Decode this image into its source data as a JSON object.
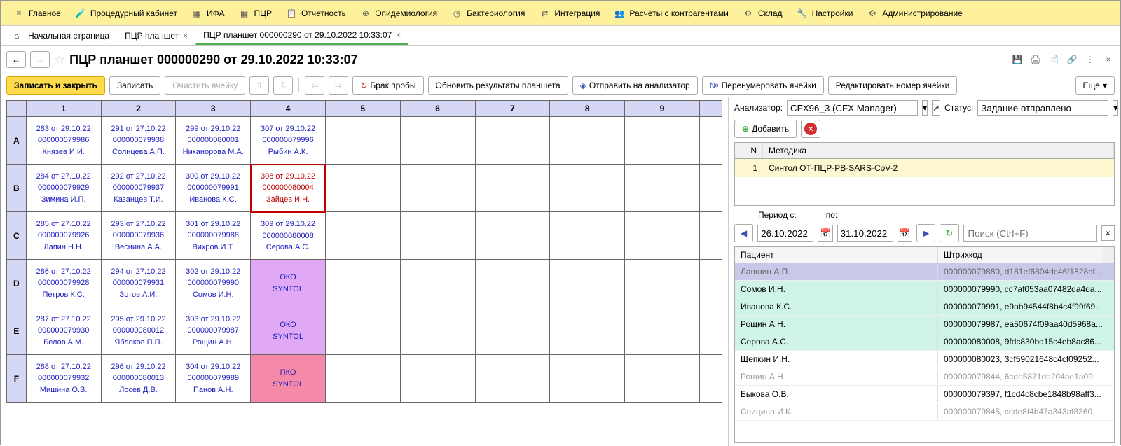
{
  "menubar": {
    "items": [
      {
        "label": "Главное",
        "icon": "menu-icon"
      },
      {
        "label": "Процедурный кабинет",
        "icon": "test-tube-icon"
      },
      {
        "label": "ИФА",
        "icon": "grid-icon"
      },
      {
        "label": "ПЦР",
        "icon": "grid-icon"
      },
      {
        "label": "Отчетность",
        "icon": "clipboard-icon"
      },
      {
        "label": "Эпидемиология",
        "icon": "globe-icon"
      },
      {
        "label": "Бактериология",
        "icon": "clock-icon"
      },
      {
        "label": "Интеграция",
        "icon": "sync-icon"
      },
      {
        "label": "Расчеты с контрагентами",
        "icon": "people-icon"
      },
      {
        "label": "Склад",
        "icon": "settings-icon"
      },
      {
        "label": "Настройки",
        "icon": "wrench-icon"
      },
      {
        "label": "Администрирование",
        "icon": "gear-icon"
      }
    ]
  },
  "tabs": [
    {
      "label": "Начальная страница",
      "closable": false,
      "active": false
    },
    {
      "label": "ПЦР планшет",
      "closable": true,
      "active": false
    },
    {
      "label": "ПЦР планшет 000000290 от 29.10.2022 10:33:07",
      "closable": true,
      "active": true
    }
  ],
  "title": "ПЦР планшет 000000290 от 29.10.2022 10:33:07",
  "toolbar": {
    "save_close": "Записать и закрыть",
    "save": "Записать",
    "clear_cell": "Очистить ячейку",
    "reject": "Брак пробы",
    "refresh_results": "Обновить результаты планшета",
    "send_analyzer": "Отправить на анализатор",
    "renumber": "Перенумеровать ячейки",
    "edit_cell_num": "Редактировать номер ячейки",
    "more": "Еще"
  },
  "plate": {
    "cols": [
      "1",
      "2",
      "3",
      "4",
      "5",
      "6",
      "7",
      "8",
      "9"
    ],
    "rows": [
      "A",
      "B",
      "C",
      "D",
      "E",
      "F"
    ],
    "cells": {
      "A1": {
        "l1": "283 от 29.10.22",
        "l2": "000000079986",
        "l3": "Князев И.И."
      },
      "A2": {
        "l1": "291 от 27.10.22",
        "l2": "000000079938",
        "l3": "Солнцева А.П."
      },
      "A3": {
        "l1": "299 от 29.10.22",
        "l2": "000000080001",
        "l3": "Никанорова М.А."
      },
      "A4": {
        "l1": "307 от 29.10.22",
        "l2": "000000079996",
        "l3": "Рыбин А.К."
      },
      "B1": {
        "l1": "284 от 27.10.22",
        "l2": "000000079929",
        "l3": "Зимина И.П."
      },
      "B2": {
        "l1": "292 от 27.10.22",
        "l2": "000000079937",
        "l3": "Казанцев Т.И."
      },
      "B3": {
        "l1": "300 от 29.10.22",
        "l2": "000000079991",
        "l3": "Иванова К.С."
      },
      "B4": {
        "l1": "308 от 29.10.22",
        "l2": "000000080004",
        "l3": "Зайцев И.Н.",
        "cls": "red"
      },
      "C1": {
        "l1": "285 от 27.10.22",
        "l2": "000000079926",
        "l3": "Лапин Н.Н."
      },
      "C2": {
        "l1": "293 от 27.10.22",
        "l2": "000000079936",
        "l3": "Веснина А.А."
      },
      "C3": {
        "l1": "301 от 29.10.22",
        "l2": "000000079988",
        "l3": "Вихров И.Т."
      },
      "C4": {
        "l1": "309 от 29.10.22",
        "l2": "000000080008",
        "l3": "Серова А.С."
      },
      "D1": {
        "l1": "286 от 27.10.22",
        "l2": "000000079928",
        "l3": "Петров К.С."
      },
      "D2": {
        "l1": "294 от 27.10.22",
        "l2": "000000079931",
        "l3": "Зотов А.И."
      },
      "D3": {
        "l1": "302 от 29.10.22",
        "l2": "000000079990",
        "l3": "Сомов И.Н."
      },
      "D4": {
        "l1": "ОКО",
        "l2": "SYNTOL",
        "cls": "oko"
      },
      "E1": {
        "l1": "287 от 27.10.22",
        "l2": "000000079930",
        "l3": "Белов А.М."
      },
      "E2": {
        "l1": "295 от 29.10.22",
        "l2": "000000080012",
        "l3": "Яблоков П.П."
      },
      "E3": {
        "l1": "303 от 29.10.22",
        "l2": "000000079987",
        "l3": "Рощин А.Н."
      },
      "E4": {
        "l1": "ОКО",
        "l2": "SYNTOL",
        "cls": "oko"
      },
      "F1": {
        "l1": "288 от 27.10.22",
        "l2": "000000079932",
        "l3": "Мишина О.В."
      },
      "F2": {
        "l1": "296 от 29.10.22",
        "l2": "000000080013",
        "l3": "Лосев Д.В."
      },
      "F3": {
        "l1": "304 от 29.10.22",
        "l2": "000000079989",
        "l3": "Панов А.Н."
      },
      "F4": {
        "l1": "ПКО",
        "l2": "SYNTOL",
        "cls": "pko"
      }
    }
  },
  "right": {
    "analyzer_label": "Анализатор:",
    "analyzer_value": "CFX96_3 (CFX Manager)",
    "status_label": "Статус:",
    "status_value": "Задание отправлено",
    "add_btn": "Добавить",
    "table_headers": {
      "n": "N",
      "method": "Методика"
    },
    "methods": [
      {
        "n": "1",
        "method": "Синтол ОТ-ПЦР-РВ-SARS-CoV-2"
      }
    ],
    "period_from_label": "Период с:",
    "period_to_label": "по:",
    "period_from": "26.10.2022",
    "period_to": "31.10.2022",
    "search_placeholder": "Поиск (Ctrl+F)",
    "patients_headers": {
      "patient": "Пациент",
      "barcode": "Штрихкод"
    },
    "patients": [
      {
        "name": "Лапшин А.П.",
        "barcode": "000000079880, d181ef6804dc46f1828cf...",
        "cls": "sel"
      },
      {
        "name": "Сомов И.Н.",
        "barcode": "000000079990, cc7af053aa07482da4da...",
        "cls": "green"
      },
      {
        "name": "Иванова К.С.",
        "barcode": "000000079991, e9ab94544f8b4c4f99f69...",
        "cls": "green"
      },
      {
        "name": "Рощин А.Н.",
        "barcode": "000000079987, ea50674f09aa40d5968a...",
        "cls": "green"
      },
      {
        "name": "Серова А.С.",
        "barcode": "000000080008, 9fdc830bd15c4eb8ac86...",
        "cls": "green"
      },
      {
        "name": "Щепкин И.Н.",
        "barcode": "000000080023, 3cf59021648c4cf09252...",
        "cls": ""
      },
      {
        "name": "Рощин А.Н.",
        "barcode": "000000079844, 6cde5871dd204ae1a09...",
        "cls": "dim"
      },
      {
        "name": "Быкова О.В.",
        "barcode": "000000079397, f1cd4c8cbe1848b98aff3...",
        "cls": ""
      },
      {
        "name": "Спицина И.К.",
        "barcode": "000000079845, ccde8f4b47a343af8360...",
        "cls": "dim"
      }
    ]
  }
}
